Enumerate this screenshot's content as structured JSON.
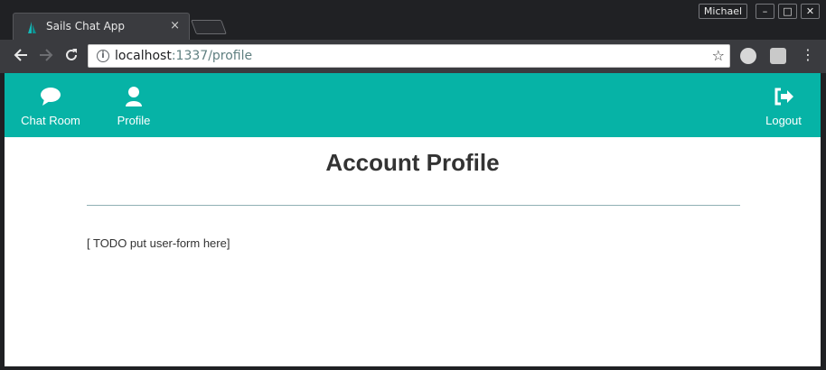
{
  "browser": {
    "tab": {
      "title": "Sails Chat App",
      "close": "×"
    },
    "profile_name": "Michael",
    "window_controls": {
      "minimize": "–",
      "maximize": "□",
      "close": "✕"
    },
    "url": {
      "host": "localhost",
      "path": ":1337/profile"
    }
  },
  "app": {
    "nav": {
      "chat_room": "Chat Room",
      "profile": "Profile",
      "logout": "Logout"
    },
    "title": "Account Profile",
    "placeholder": "[ TODO put user-form here]"
  },
  "colors": {
    "navbar": "#06b3a6",
    "chrome_dark": "#202124",
    "toolbar": "#3a3b3f"
  },
  "icons": [
    "sails-favicon-icon",
    "back-arrow-icon",
    "forward-arrow-icon",
    "reload-icon",
    "info-icon",
    "star-icon",
    "extension-icon",
    "menu-icon",
    "chat-bubble-icon",
    "user-icon",
    "logout-icon"
  ]
}
